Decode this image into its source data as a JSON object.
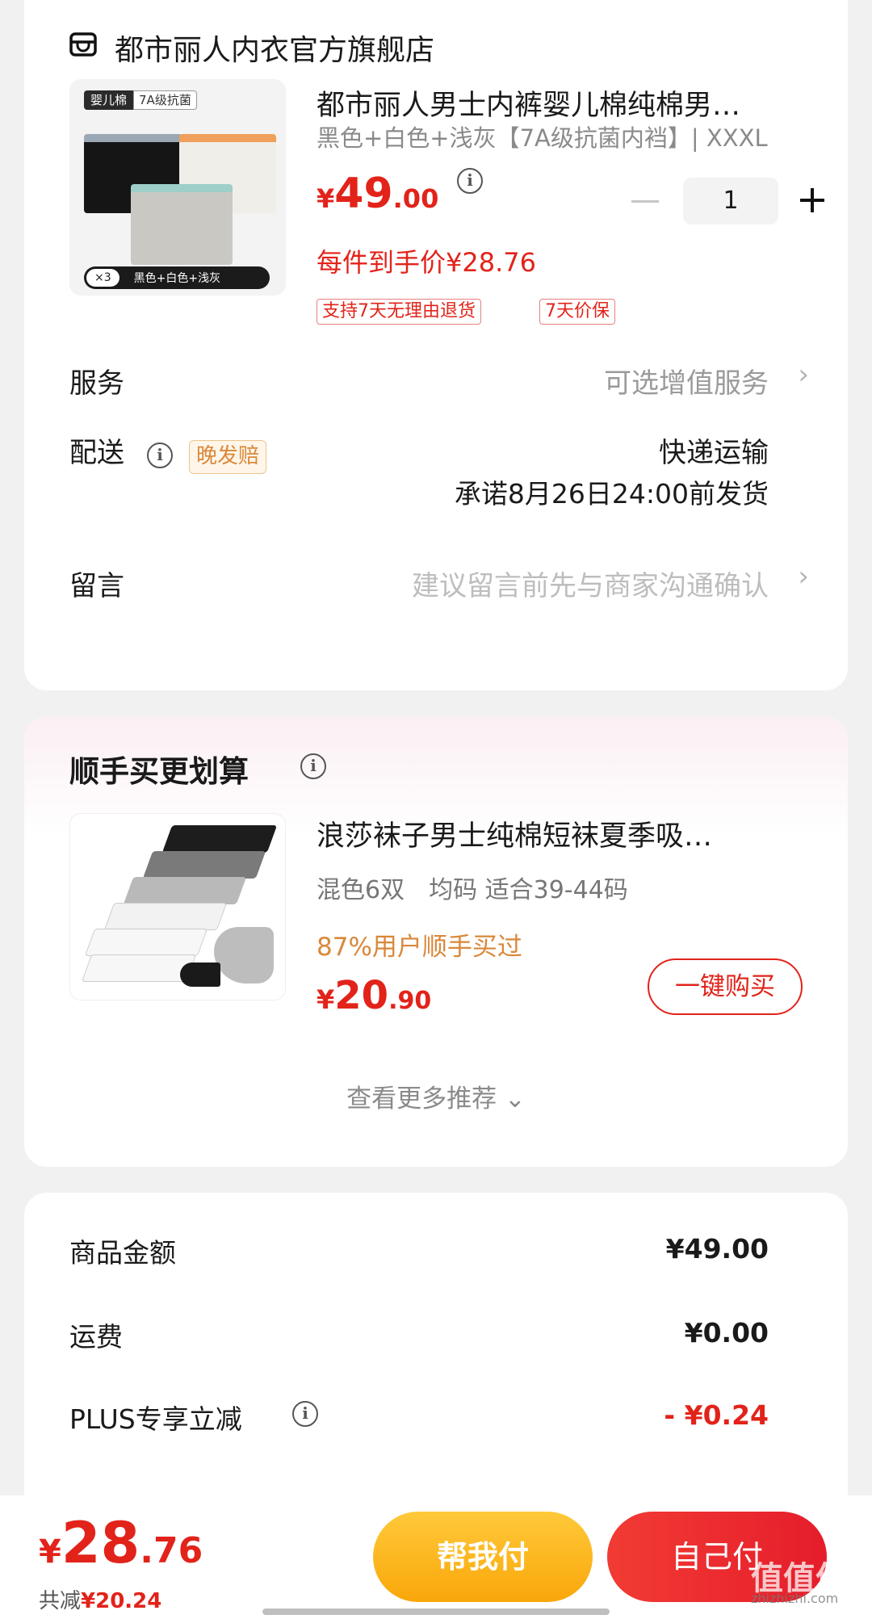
{
  "shop": {
    "name": "都市丽人内衣官方旗舰店",
    "product": {
      "image_tags": [
        "婴儿棉",
        "7A级抗菌"
      ],
      "image_pack": "×3",
      "image_colors": "黑色+白色+浅灰",
      "title": "都市丽人男士内裤婴儿棉纯棉男…",
      "spec": "黑色+白色+浅灰【7A级抗菌内裆】| XXXL",
      "price_currency": "¥",
      "price_int": "49",
      "price_dec": ".00",
      "quantity": "1",
      "final_price": "每件到手价¥28.76",
      "promo_tags": [
        "支持7天无理由退货",
        "7天价保"
      ]
    },
    "service": {
      "label": "服务",
      "value": "可选增值服务",
      "chevron": "›"
    },
    "delivery": {
      "label": "配送",
      "tag": "晚发赔",
      "method": "快递运输",
      "promise": "承诺8月26日24:00前发货"
    },
    "message": {
      "label": "留言",
      "hint": "建议留言前先与商家沟通确认",
      "chevron": "›"
    }
  },
  "recommend": {
    "title": "顺手买更划算",
    "item": {
      "name": "浪莎袜子男士纯棉短袜夏季吸…",
      "spec": "混色6双　均码 适合39-44码",
      "social": "87%用户顺手买过",
      "price_currency": "¥",
      "price_int": "20",
      "price_dec": ".90",
      "buy_label": "一键购买"
    },
    "more_label": "查看更多推荐 ⌄"
  },
  "summary": {
    "rows": [
      {
        "label": "商品金额",
        "value": "¥49.00"
      },
      {
        "label": "运费",
        "value": "¥0.00"
      },
      {
        "label": "PLUS专享立减",
        "value": "- ¥0.24"
      }
    ]
  },
  "bottom": {
    "total_currency": "¥",
    "total_int": "28",
    "total_dec": ".76",
    "saved_label": "共减",
    "saved_value": "¥20.24",
    "help_pay": "帮我付",
    "self_pay": "自己付",
    "watermark": "值值值",
    "watermark_sub": "zhizhizhi.com"
  },
  "colors": {
    "accent_red": "#e2231a",
    "accent_orange": "#d9883a",
    "help_button": "#f9a70a"
  },
  "icons": [
    "shop-icon",
    "info-icon",
    "minus-icon",
    "plus-icon",
    "chevron-right-icon",
    "chevron-down-icon"
  ]
}
